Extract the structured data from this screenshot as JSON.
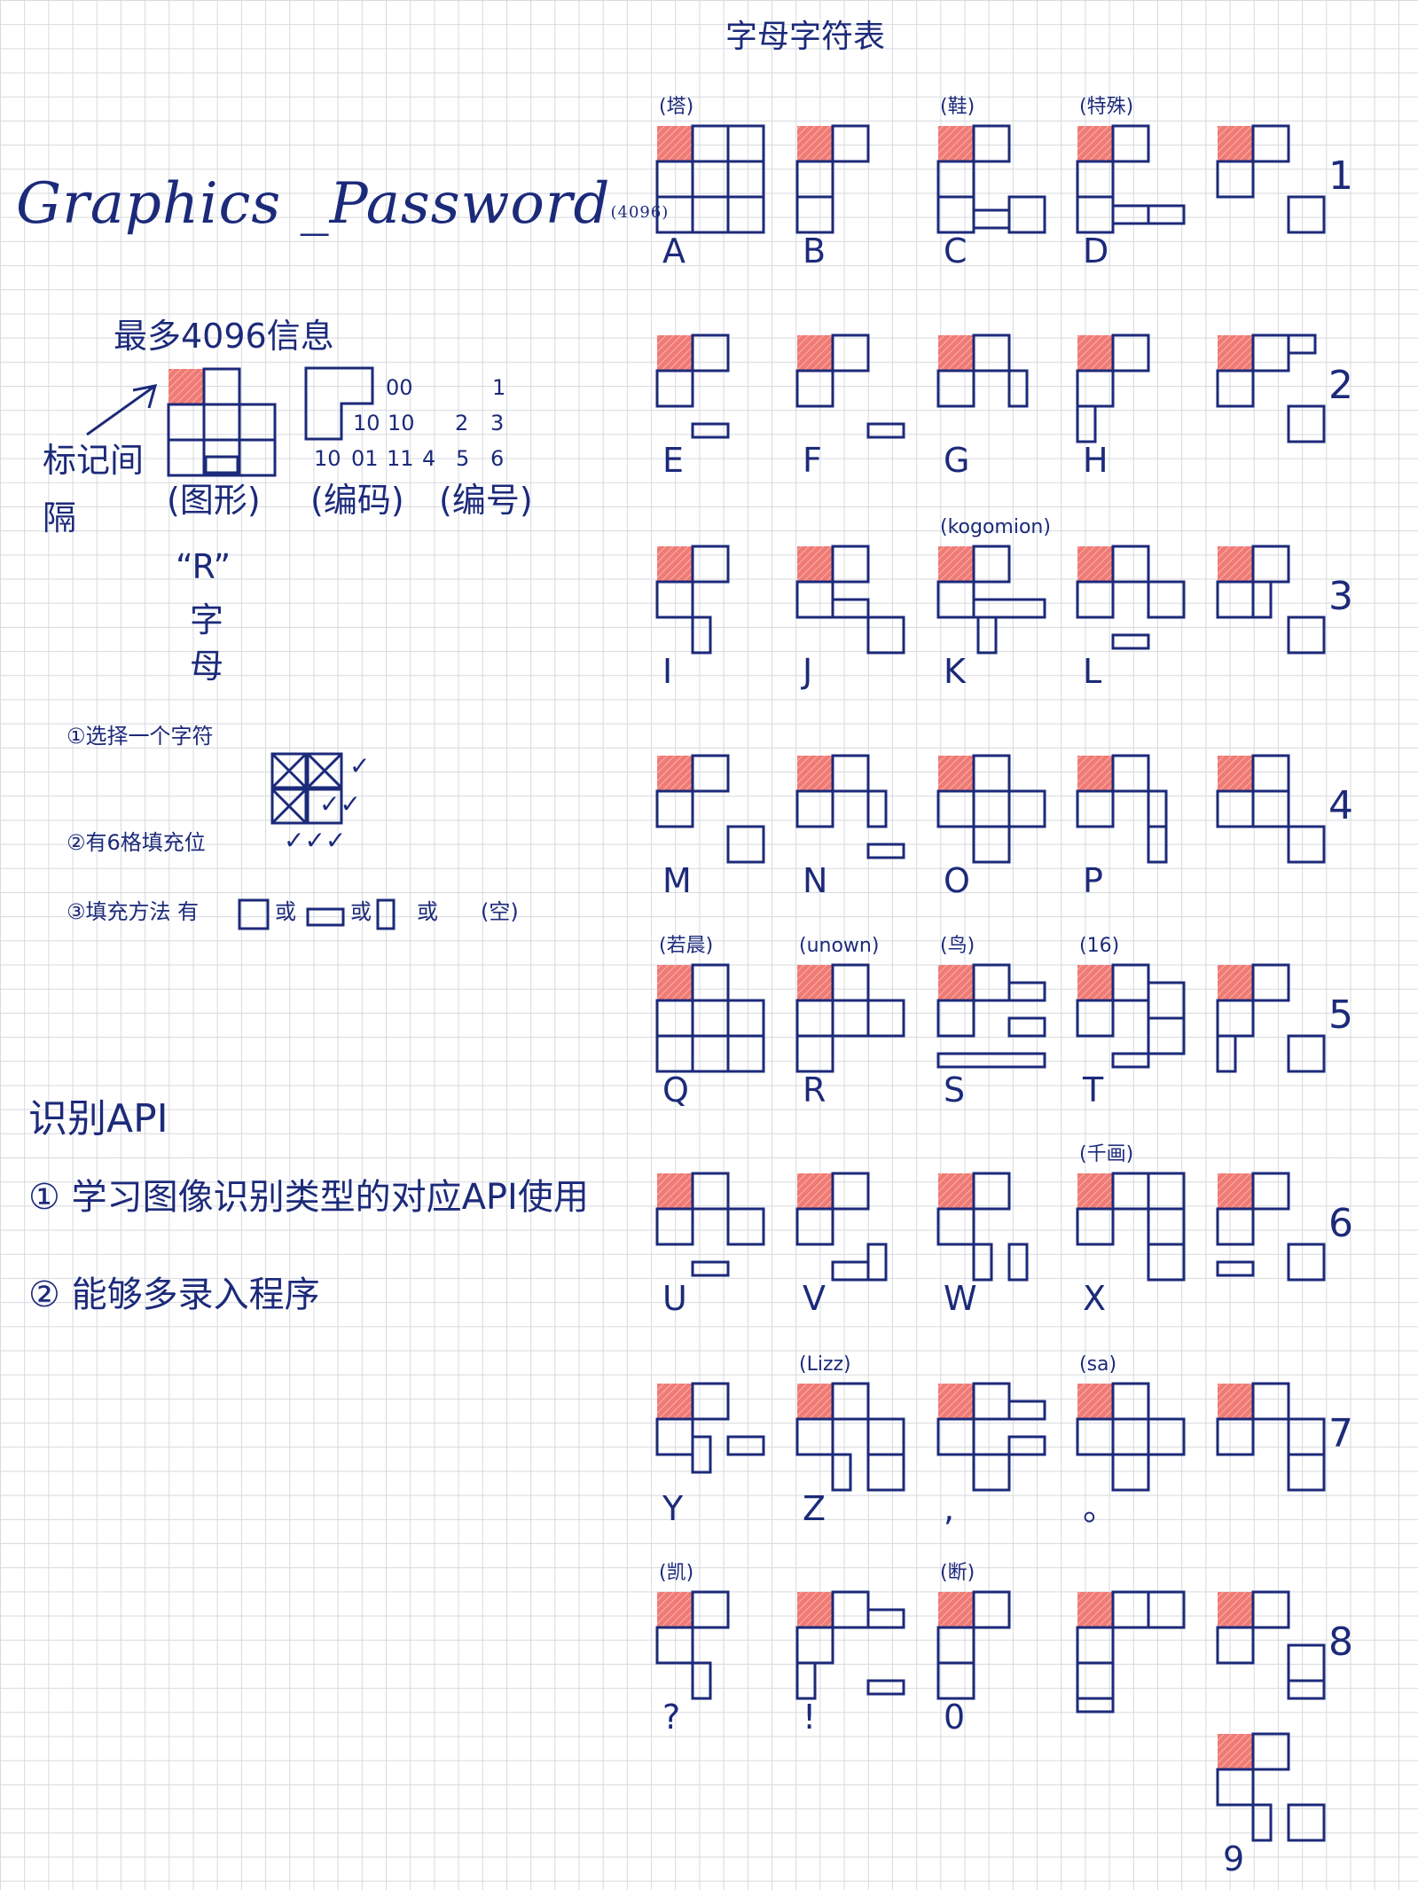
{
  "title": {
    "main": "Graphics _Password",
    "suffix": "(4096)"
  },
  "sheet_title": "字母字符表",
  "left": {
    "max_info": "最多4096信息",
    "mark_interval": [
      "标记间",
      "隔"
    ],
    "labels": [
      "(图形)",
      "(编码)",
      "(编号)"
    ],
    "code_numbers": {
      "row1": [
        "00",
        "1"
      ],
      "row2": [
        "10",
        "10",
        "2",
        "3"
      ],
      "row3": [
        "10",
        "01",
        "11",
        "4",
        "5",
        "6"
      ]
    },
    "example_letter": "“R”",
    "example_word": [
      "字",
      "母"
    ],
    "steps": [
      "①选择一个字符",
      "②有6格填充位",
      "③填充方法 有",
      "或",
      "或",
      "或",
      "(空)"
    ],
    "checks": [
      "✓",
      "✓✓",
      "✓✓✓"
    ],
    "api_title": "识别API",
    "api_items": [
      "① 学习图像识别类型的对应API使用",
      "② 能够多录入程序"
    ]
  },
  "cards": [
    {
      "label": "A",
      "note": "(塔)"
    },
    {
      "label": "B",
      "note": ""
    },
    {
      "label": "C",
      "note": "(鞋)"
    },
    {
      "label": "D",
      "note": "(特殊)"
    },
    {
      "label": "1",
      "note": ""
    },
    {
      "label": "E",
      "note": ""
    },
    {
      "label": "F",
      "note": ""
    },
    {
      "label": "G",
      "note": ""
    },
    {
      "label": "H",
      "note": ""
    },
    {
      "label": "2",
      "note": ""
    },
    {
      "label": "I",
      "note": ""
    },
    {
      "label": "J",
      "note": ""
    },
    {
      "label": "K",
      "note": "(kogomion)"
    },
    {
      "label": "L",
      "note": ""
    },
    {
      "label": "3",
      "note": ""
    },
    {
      "label": "M",
      "note": ""
    },
    {
      "label": "N",
      "note": ""
    },
    {
      "label": "O",
      "note": ""
    },
    {
      "label": "P",
      "note": ""
    },
    {
      "label": "4",
      "note": ""
    },
    {
      "label": "Q",
      "note": "(若晨)"
    },
    {
      "label": "R",
      "note": "(unown)"
    },
    {
      "label": "S",
      "note": "(鸟)"
    },
    {
      "label": "T",
      "note": "(16)"
    },
    {
      "label": "5",
      "note": ""
    },
    {
      "label": "U",
      "note": ""
    },
    {
      "label": "V",
      "note": ""
    },
    {
      "label": "W",
      "note": ""
    },
    {
      "label": "X",
      "note": "(千画)"
    },
    {
      "label": "6",
      "note": ""
    },
    {
      "label": "Y",
      "note": ""
    },
    {
      "label": "Z",
      "note": "(Lizz)"
    },
    {
      "label": ",",
      "note": ""
    },
    {
      "label": "。",
      "note": "(sa)"
    },
    {
      "label": "7",
      "note": ""
    },
    {
      "label": "?",
      "note": "(凯)"
    },
    {
      "label": "!",
      "note": ""
    },
    {
      "label": "0",
      "note": "(断)"
    },
    {
      "label": "",
      "note": ""
    },
    {
      "label": "8",
      "note": ""
    },
    {
      "label": "9",
      "note": ""
    }
  ],
  "colors": {
    "ink": "#1c2a7a",
    "marker": "#f07a74",
    "grid": "#d7d9de"
  }
}
